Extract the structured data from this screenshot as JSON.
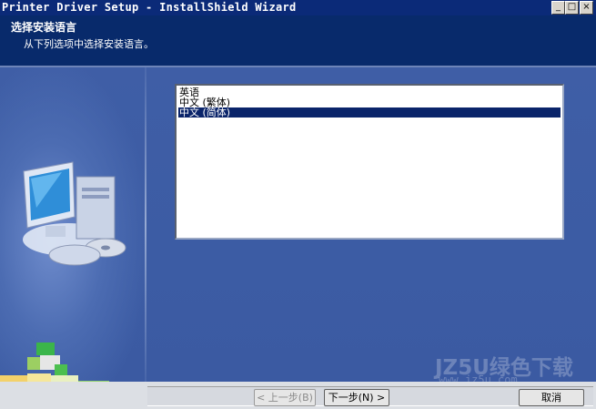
{
  "window": {
    "title": "Printer Driver Setup - InstallShield Wizard",
    "minimize_glyph": "_",
    "maximize_glyph": "□",
    "close_glyph": "×"
  },
  "header": {
    "title": "选择安装语言",
    "subtitle": "从下列选项中选择安装语言。"
  },
  "language_list": {
    "items": [
      {
        "label": "英语",
        "selected": false
      },
      {
        "label": "中文 (繁体)",
        "selected": false
      },
      {
        "label": "中文 (简体)",
        "selected": true
      }
    ]
  },
  "buttons": {
    "back": {
      "text": "< 上一步(B)",
      "enabled": false
    },
    "next": {
      "text": "下一步(N) >",
      "enabled": true
    },
    "cancel": {
      "text": "取消",
      "enabled": true
    }
  },
  "watermark": {
    "text": "JZ5U绿色下载",
    "url": "www.jz5u.com"
  },
  "colors": {
    "title_bar": "#0b2a78",
    "header": "#082a6b",
    "body": "#3f5ea6",
    "selection": "#0a246a"
  }
}
